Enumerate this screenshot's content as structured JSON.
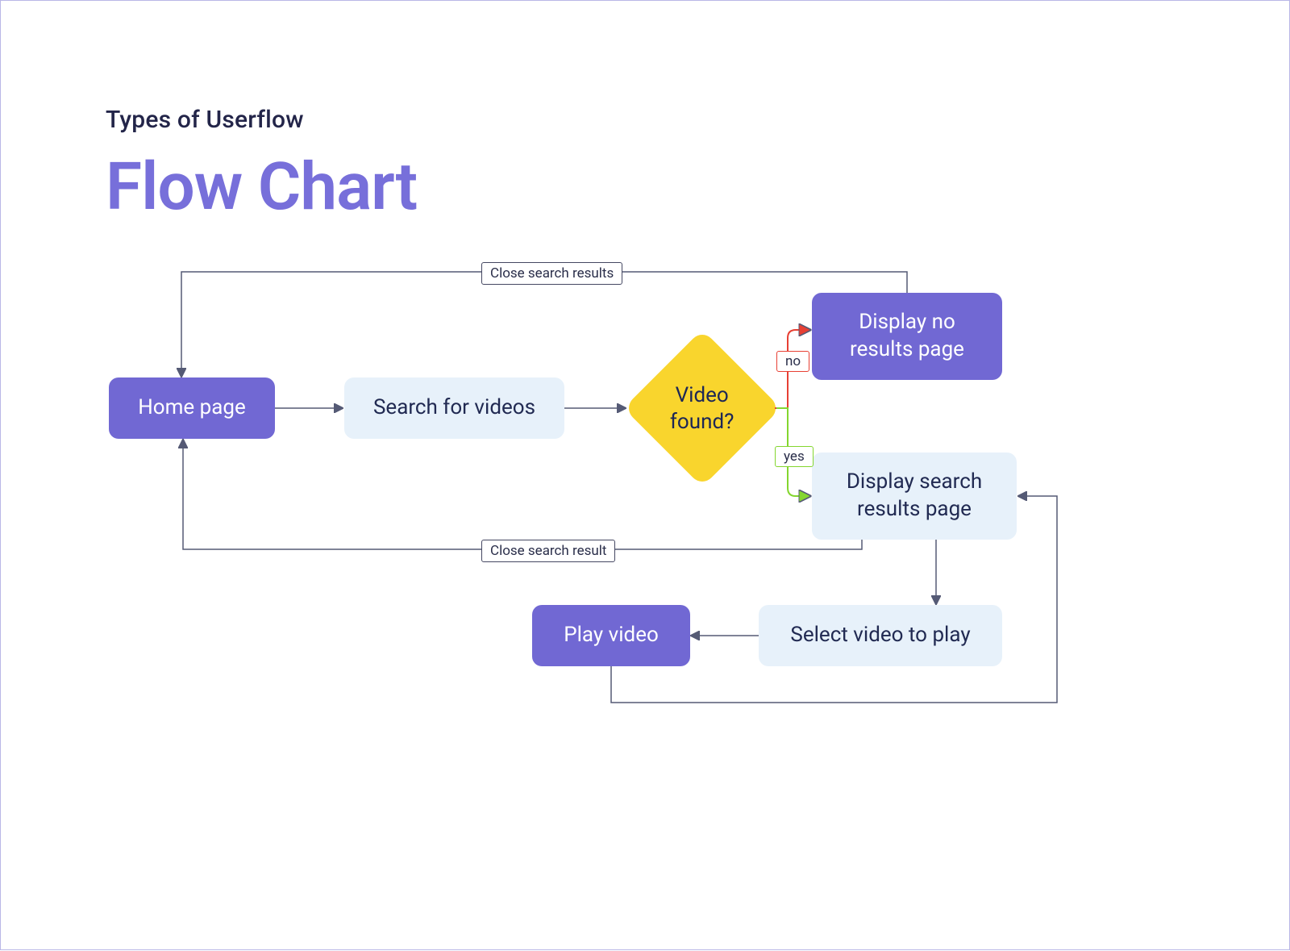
{
  "header": {
    "subtitle": "Types of Userflow",
    "title": "Flow Chart"
  },
  "nodes": {
    "home": "Home page",
    "search": "Search for videos",
    "decision": "Video found?",
    "no_results": "Display no results page",
    "search_results": "Display search results page",
    "select": "Select video to play",
    "play": "Play video"
  },
  "edges": {
    "close_results_top": "Close search results",
    "close_results_bottom": "Close search result",
    "no": "no",
    "yes": "yes"
  },
  "colors": {
    "page": "#7168d3",
    "action": "#e7f1fa",
    "decision": "#f9d52d",
    "line": "#555a75",
    "no": "#e74034",
    "yes": "#84d62f",
    "title": "#776fda",
    "text": "#212a52"
  }
}
